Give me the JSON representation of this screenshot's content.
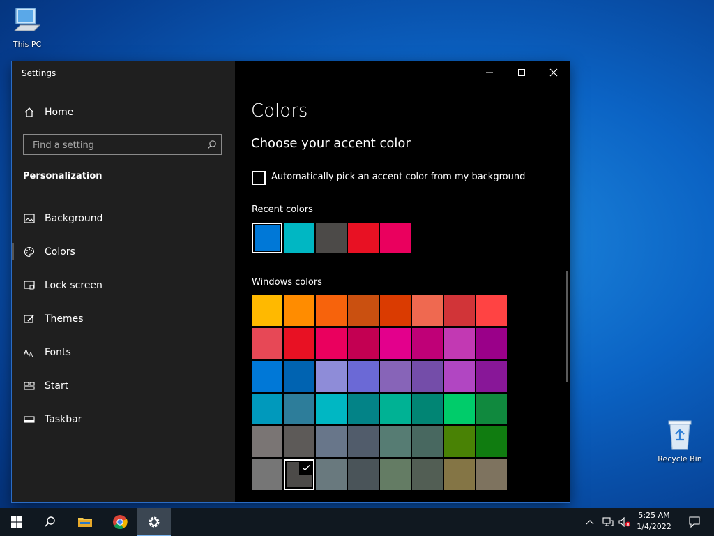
{
  "desktop": {
    "icons": [
      {
        "label": "This PC"
      },
      {
        "label": "Recycle Bin"
      }
    ]
  },
  "window": {
    "title": "Settings",
    "controls": [
      "minimize",
      "maximize",
      "close"
    ]
  },
  "sidebar": {
    "home_label": "Home",
    "search_placeholder": "Find a setting",
    "section_title": "Personalization",
    "items": [
      {
        "label": "Background",
        "icon": "picture-icon"
      },
      {
        "label": "Colors",
        "icon": "palette-icon",
        "selected": true
      },
      {
        "label": "Lock screen",
        "icon": "lock-screen-icon"
      },
      {
        "label": "Themes",
        "icon": "themes-icon"
      },
      {
        "label": "Fonts",
        "icon": "fonts-icon"
      },
      {
        "label": "Start",
        "icon": "start-icon"
      },
      {
        "label": "Taskbar",
        "icon": "taskbar-icon"
      }
    ]
  },
  "main": {
    "page_title": "Colors",
    "subtitle": "Choose your accent color",
    "auto_pick_label": "Automatically pick an accent color from my background",
    "auto_pick_checked": false,
    "recent_colors_label": "Recent colors",
    "recent_colors": [
      "#0078d7",
      "#00b7c3",
      "#4c4a48",
      "#e81123",
      "#ea005e"
    ],
    "windows_colors_label": "Windows colors",
    "windows_colors": [
      [
        "#ffb900",
        "#ff8c00",
        "#f7630c",
        "#ca5010",
        "#da3b01",
        "#ef6950",
        "#d13438",
        "#ff4343"
      ],
      [
        "#e74856",
        "#e81123",
        "#ea005e",
        "#c30052",
        "#e3008c",
        "#bf0077",
        "#c239b3",
        "#9a0089"
      ],
      [
        "#0078d7",
        "#0063b1",
        "#8e8cd8",
        "#6b69d6",
        "#8764b8",
        "#744da9",
        "#b146c2",
        "#881798"
      ],
      [
        "#0099bc",
        "#2d7d9a",
        "#00b7c3",
        "#038387",
        "#00b294",
        "#018574",
        "#00cc6a",
        "#10893e"
      ],
      [
        "#7a7574",
        "#5d5a58",
        "#68768a",
        "#515c6b",
        "#567c73",
        "#486860",
        "#498205",
        "#107c10"
      ],
      [
        "#767676",
        "#4c4a48",
        "#69797e",
        "#4a5459",
        "#647c64",
        "#525e54",
        "#847545",
        "#7e735f"
      ]
    ],
    "selected_color": "#4c4a48"
  },
  "taskbar": {
    "buttons": [
      "start-button",
      "search-button",
      "file-explorer-button",
      "chrome-button",
      "settings-button"
    ],
    "active": "settings-button",
    "time": "5:25 AM",
    "date": "1/4/2022"
  }
}
